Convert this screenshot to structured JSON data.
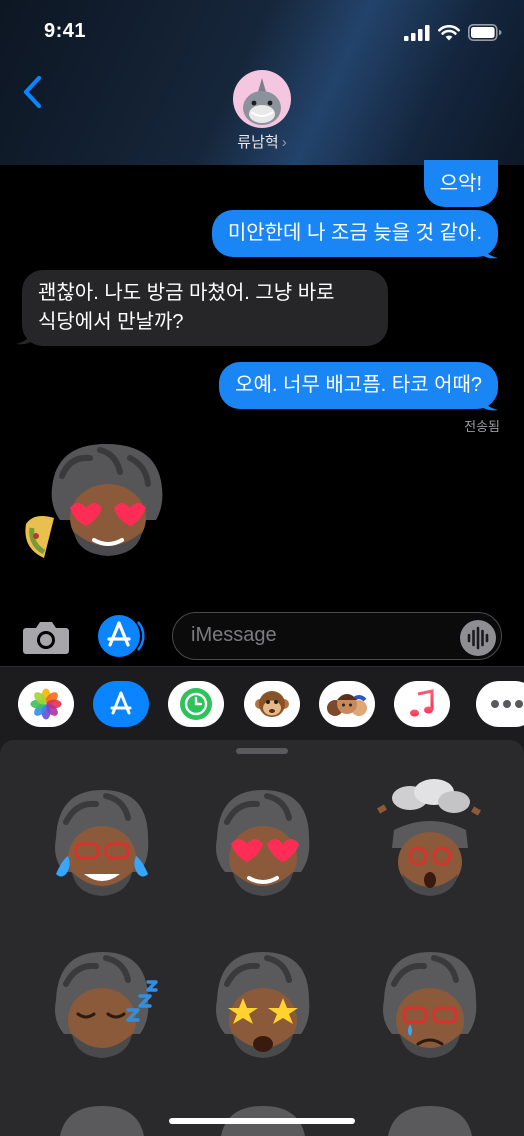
{
  "status_bar": {
    "time": "9:41"
  },
  "contact": {
    "name": "류남혁",
    "chevron": "›"
  },
  "messages": [
    {
      "text": "으악!",
      "direction": "outgoing"
    },
    {
      "text": "미안한데 나 조금 늦을 것 같아.",
      "direction": "outgoing"
    },
    {
      "line1": "괜찮아. 나도 방금 마쳤어. 그냥 바로",
      "line2": "식당에서 만날까?",
      "direction": "incoming"
    },
    {
      "text": "오예. 너무 배고픔. 타코 어때?",
      "direction": "outgoing"
    }
  ],
  "delivered_label": "전송됨",
  "composer": {
    "placeholder": "iMessage"
  },
  "app_strip": [
    {
      "icon": "photos-icon"
    },
    {
      "icon": "app-store-icon"
    },
    {
      "icon": "screen-time-icon"
    },
    {
      "icon": "animoji-icon"
    },
    {
      "icon": "memoji-stickers-icon"
    },
    {
      "icon": "music-icon"
    },
    {
      "icon": "more-icon"
    }
  ],
  "stickers": [
    {
      "name": "memoji-tears-of-joy"
    },
    {
      "name": "memoji-heart-eyes"
    },
    {
      "name": "memoji-mind-blown"
    },
    {
      "name": "memoji-sleeping"
    },
    {
      "name": "memoji-star-struck"
    },
    {
      "name": "memoji-crying"
    }
  ],
  "colors": {
    "outgoing_bubble": "#1a86f5",
    "incoming_bubble": "#262628",
    "accent": "#0a84ff",
    "drawer_bg": "#1c1c1e"
  }
}
